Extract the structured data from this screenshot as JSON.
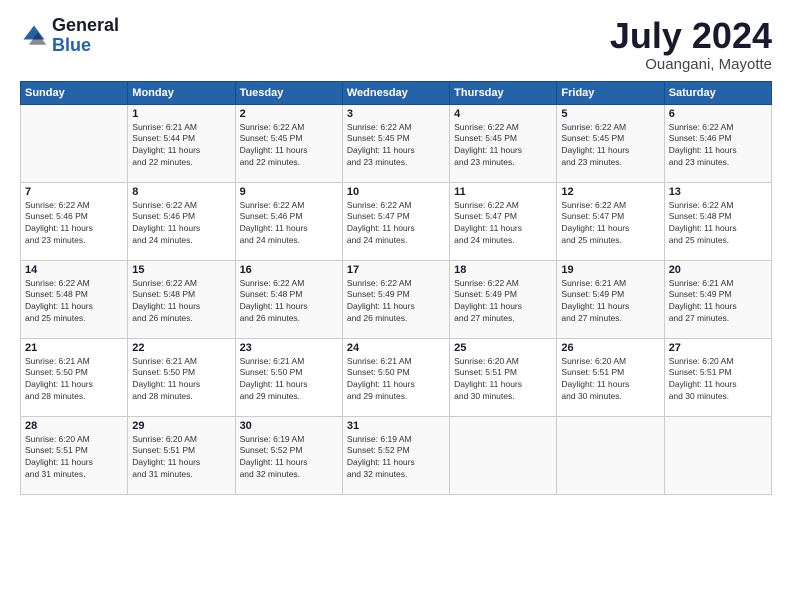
{
  "logo": {
    "general": "General",
    "blue": "Blue"
  },
  "title": {
    "month_year": "July 2024",
    "location": "Ouangani, Mayotte"
  },
  "headers": [
    "Sunday",
    "Monday",
    "Tuesday",
    "Wednesday",
    "Thursday",
    "Friday",
    "Saturday"
  ],
  "weeks": [
    [
      {
        "day": "",
        "content": ""
      },
      {
        "day": "1",
        "content": "Sunrise: 6:21 AM\nSunset: 5:44 PM\nDaylight: 11 hours\nand 22 minutes."
      },
      {
        "day": "2",
        "content": "Sunrise: 6:22 AM\nSunset: 5:45 PM\nDaylight: 11 hours\nand 22 minutes."
      },
      {
        "day": "3",
        "content": "Sunrise: 6:22 AM\nSunset: 5:45 PM\nDaylight: 11 hours\nand 23 minutes."
      },
      {
        "day": "4",
        "content": "Sunrise: 6:22 AM\nSunset: 5:45 PM\nDaylight: 11 hours\nand 23 minutes."
      },
      {
        "day": "5",
        "content": "Sunrise: 6:22 AM\nSunset: 5:45 PM\nDaylight: 11 hours\nand 23 minutes."
      },
      {
        "day": "6",
        "content": "Sunrise: 6:22 AM\nSunset: 5:46 PM\nDaylight: 11 hours\nand 23 minutes."
      }
    ],
    [
      {
        "day": "7",
        "content": "Sunrise: 6:22 AM\nSunset: 5:46 PM\nDaylight: 11 hours\nand 23 minutes."
      },
      {
        "day": "8",
        "content": "Sunrise: 6:22 AM\nSunset: 5:46 PM\nDaylight: 11 hours\nand 24 minutes."
      },
      {
        "day": "9",
        "content": "Sunrise: 6:22 AM\nSunset: 5:46 PM\nDaylight: 11 hours\nand 24 minutes."
      },
      {
        "day": "10",
        "content": "Sunrise: 6:22 AM\nSunset: 5:47 PM\nDaylight: 11 hours\nand 24 minutes."
      },
      {
        "day": "11",
        "content": "Sunrise: 6:22 AM\nSunset: 5:47 PM\nDaylight: 11 hours\nand 24 minutes."
      },
      {
        "day": "12",
        "content": "Sunrise: 6:22 AM\nSunset: 5:47 PM\nDaylight: 11 hours\nand 25 minutes."
      },
      {
        "day": "13",
        "content": "Sunrise: 6:22 AM\nSunset: 5:48 PM\nDaylight: 11 hours\nand 25 minutes."
      }
    ],
    [
      {
        "day": "14",
        "content": "Sunrise: 6:22 AM\nSunset: 5:48 PM\nDaylight: 11 hours\nand 25 minutes."
      },
      {
        "day": "15",
        "content": "Sunrise: 6:22 AM\nSunset: 5:48 PM\nDaylight: 11 hours\nand 26 minutes."
      },
      {
        "day": "16",
        "content": "Sunrise: 6:22 AM\nSunset: 5:48 PM\nDaylight: 11 hours\nand 26 minutes."
      },
      {
        "day": "17",
        "content": "Sunrise: 6:22 AM\nSunset: 5:49 PM\nDaylight: 11 hours\nand 26 minutes."
      },
      {
        "day": "18",
        "content": "Sunrise: 6:22 AM\nSunset: 5:49 PM\nDaylight: 11 hours\nand 27 minutes."
      },
      {
        "day": "19",
        "content": "Sunrise: 6:21 AM\nSunset: 5:49 PM\nDaylight: 11 hours\nand 27 minutes."
      },
      {
        "day": "20",
        "content": "Sunrise: 6:21 AM\nSunset: 5:49 PM\nDaylight: 11 hours\nand 27 minutes."
      }
    ],
    [
      {
        "day": "21",
        "content": "Sunrise: 6:21 AM\nSunset: 5:50 PM\nDaylight: 11 hours\nand 28 minutes."
      },
      {
        "day": "22",
        "content": "Sunrise: 6:21 AM\nSunset: 5:50 PM\nDaylight: 11 hours\nand 28 minutes."
      },
      {
        "day": "23",
        "content": "Sunrise: 6:21 AM\nSunset: 5:50 PM\nDaylight: 11 hours\nand 29 minutes."
      },
      {
        "day": "24",
        "content": "Sunrise: 6:21 AM\nSunset: 5:50 PM\nDaylight: 11 hours\nand 29 minutes."
      },
      {
        "day": "25",
        "content": "Sunrise: 6:20 AM\nSunset: 5:51 PM\nDaylight: 11 hours\nand 30 minutes."
      },
      {
        "day": "26",
        "content": "Sunrise: 6:20 AM\nSunset: 5:51 PM\nDaylight: 11 hours\nand 30 minutes."
      },
      {
        "day": "27",
        "content": "Sunrise: 6:20 AM\nSunset: 5:51 PM\nDaylight: 11 hours\nand 30 minutes."
      }
    ],
    [
      {
        "day": "28",
        "content": "Sunrise: 6:20 AM\nSunset: 5:51 PM\nDaylight: 11 hours\nand 31 minutes."
      },
      {
        "day": "29",
        "content": "Sunrise: 6:20 AM\nSunset: 5:51 PM\nDaylight: 11 hours\nand 31 minutes."
      },
      {
        "day": "30",
        "content": "Sunrise: 6:19 AM\nSunset: 5:52 PM\nDaylight: 11 hours\nand 32 minutes."
      },
      {
        "day": "31",
        "content": "Sunrise: 6:19 AM\nSunset: 5:52 PM\nDaylight: 11 hours\nand 32 minutes."
      },
      {
        "day": "",
        "content": ""
      },
      {
        "day": "",
        "content": ""
      },
      {
        "day": "",
        "content": ""
      }
    ]
  ]
}
